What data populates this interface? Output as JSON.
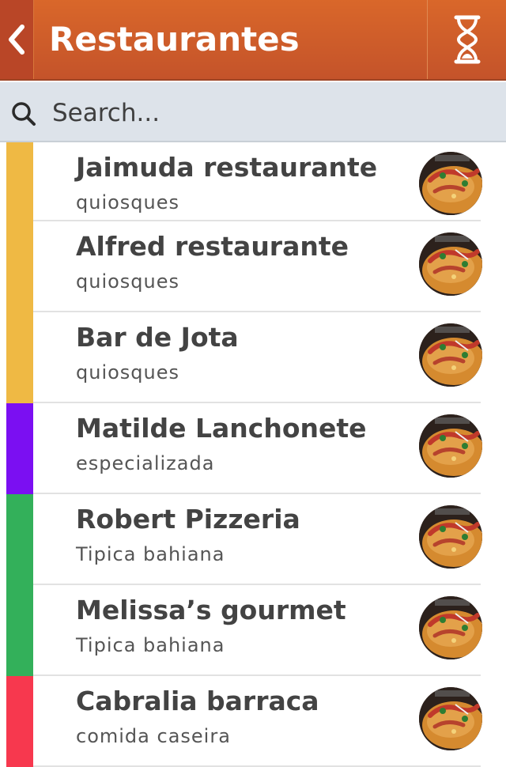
{
  "header": {
    "title": "Restaurantes",
    "back_icon": "chevron-left-icon",
    "action_icon": "hourglass-icon"
  },
  "search": {
    "placeholder": "Search..."
  },
  "restaurants": [
    {
      "name": "Jaimuda restaurante",
      "category": "quiosques",
      "color": "#efb944"
    },
    {
      "name": "Alfred restaurante",
      "category": "quiosques",
      "color": "#efb944"
    },
    {
      "name": "Bar de Jota",
      "category": "quiosques",
      "color": "#efb944"
    },
    {
      "name": "Matilde Lanchonete",
      "category": "especializada",
      "color": "#7b0ff2"
    },
    {
      "name": "Robert Pizzeria",
      "category": "Tipica bahiana",
      "color": "#33b05a"
    },
    {
      "name": "Melissa’s gourmet",
      "category": "Tipica bahiana",
      "color": "#33b05a"
    },
    {
      "name": "Cabralia barraca",
      "category": "comida caseira",
      "color": "#f7384e"
    }
  ],
  "colors": {
    "header_bg": "#c9562a",
    "search_bg": "#dde3ea"
  }
}
